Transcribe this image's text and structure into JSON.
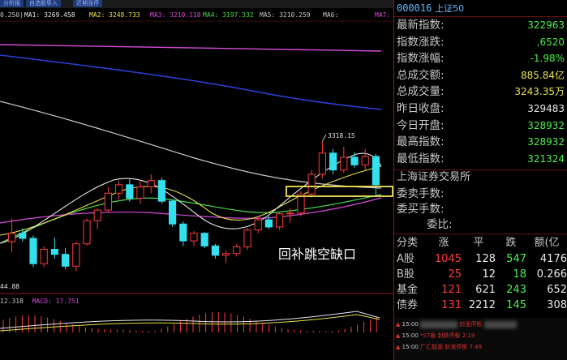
{
  "toolbar": {
    "tabs": [
      "分析报",
      "自选股导入",
      "近期涨停"
    ]
  },
  "ma_legend": [
    {
      "label": "0.250)",
      "color": "#c8c8c8"
    },
    {
      "label": "MA1: 3269.458",
      "color": "#e8e8e8"
    },
    {
      "label": "MA2: 3248.733",
      "color": "#e8e04a"
    },
    {
      "label": "MA3: 3210.118",
      "color": "#d84ad8"
    },
    {
      "label": "MA4: 3197.332",
      "color": "#4ad84a"
    },
    {
      "label": "MA5: 3210.259",
      "color": "#c8c8c8"
    },
    {
      "label": "MA6:",
      "color": "#c8c8c8"
    },
    {
      "label": "MA7:",
      "color": "#d84ad8"
    }
  ],
  "chart": {
    "peak_label": "3318.15",
    "low_label": "44.88",
    "annotation": "回补跳空缺口",
    "macd_legend": [
      {
        "label": "12.318",
        "color": "#c8c8c8"
      },
      {
        "label": "MACD: 17.751",
        "color": "#d84ad8"
      }
    ]
  },
  "chart_data": {
    "type": "candlestick",
    "series": [
      {
        "values": [
          [
            3080,
            3135,
            3055,
            3100
          ],
          [
            3100,
            3112,
            3080,
            3088
          ],
          [
            3088,
            3095,
            3020,
            3028
          ],
          [
            3028,
            3070,
            3020,
            3062
          ],
          [
            3062,
            3090,
            3040,
            3050
          ],
          [
            3050,
            3065,
            3015,
            3022
          ],
          [
            3022,
            3080,
            3010,
            3075
          ],
          [
            3075,
            3135,
            3070,
            3130
          ],
          [
            3130,
            3160,
            3110,
            3155
          ],
          [
            3155,
            3210,
            3150,
            3195
          ],
          [
            3195,
            3225,
            3180,
            3215
          ],
          [
            3215,
            3228,
            3175,
            3183
          ],
          [
            3183,
            3225,
            3170,
            3210
          ],
          [
            3210,
            3240,
            3195,
            3225
          ],
          [
            3225,
            3232,
            3170,
            3176
          ],
          [
            3176,
            3180,
            3115,
            3122
          ],
          [
            3122,
            3128,
            3070,
            3082
          ],
          [
            3082,
            3105,
            3070,
            3100
          ],
          [
            3100,
            3103,
            3065,
            3070
          ],
          [
            3070,
            3075,
            3040,
            3048
          ],
          [
            3048,
            3060,
            3030,
            3052
          ],
          [
            3052,
            3075,
            3045,
            3068
          ],
          [
            3068,
            3112,
            3060,
            3108
          ],
          [
            3108,
            3140,
            3100,
            3132
          ],
          [
            3132,
            3142,
            3110,
            3115
          ],
          [
            3115,
            3152,
            3108,
            3146
          ],
          [
            3146,
            3160,
            3125,
            3148
          ],
          [
            3148,
            3200,
            3140,
            3193
          ],
          [
            3193,
            3250,
            3185,
            3240
          ],
          [
            3240,
            3318,
            3230,
            3290
          ],
          [
            3290,
            3300,
            3240,
            3250
          ],
          [
            3250,
            3305,
            3244,
            3280
          ],
          [
            3280,
            3292,
            3255,
            3262
          ],
          [
            3262,
            3300,
            3250,
            3282
          ],
          [
            3282,
            3288,
            3190,
            3215
          ]
        ]
      }
    ]
  },
  "quote": {
    "code": "000016",
    "name": "上证50",
    "rows": [
      {
        "key": "最新指数:",
        "value": "322963",
        "color": "#4af04a"
      },
      {
        "key": "指数涨跌:",
        "value": ",6520",
        "color": "#4af04a"
      },
      {
        "key": "指数涨幅:",
        "value": "-1.98%",
        "color": "#4af04a"
      },
      {
        "key": "总成交额:",
        "value": "885.84亿",
        "color": "#e8e04a"
      },
      {
        "key": "总成交量:",
        "value": "3243.35万",
        "color": "#e8e04a"
      },
      {
        "key": "昨日收盘:",
        "value": "329483",
        "color": "#e8e8e8"
      },
      {
        "key": "今日开盘:",
        "value": "328932",
        "color": "#4af04a"
      },
      {
        "key": "最高指数:",
        "value": "328932",
        "color": "#4af04a"
      },
      {
        "key": "最低指数:",
        "value": "321324",
        "color": "#4af04a"
      }
    ],
    "exchange": "上海证券交易所",
    "order_rows": [
      {
        "key": "委卖手数:"
      },
      {
        "key": "委买手数:"
      },
      {
        "key": "委比:"
      }
    ]
  },
  "breadth": {
    "headers": [
      "分类",
      "涨",
      "平",
      "跌",
      "额(亿"
    ],
    "rows": [
      {
        "cat": "A股",
        "up": "1045",
        "flat": "128",
        "down": "547",
        "amt": "4176"
      },
      {
        "cat": "B股",
        "up": "25",
        "flat": "12",
        "down": "18",
        "amt": "0.266"
      },
      {
        "cat": "基金",
        "up": "121",
        "flat": "621",
        "down": "243",
        "amt": "652"
      },
      {
        "cat": "债券",
        "up": "131",
        "flat": "2212",
        "down": "145",
        "amt": "308"
      }
    ]
  },
  "ticker": {
    "rows": [
      {
        "time": "15:00",
        "text": "封涨停板"
      },
      {
        "time": "15:00",
        "text": "*ST盾 封跌停板 2.19"
      },
      {
        "time": "15:00",
        "text": "广汇能源 封涨停板 7.49"
      }
    ]
  },
  "colors": {
    "up": "#ff3b3b",
    "down": "#34e0f0",
    "accent": "#5fb8ff",
    "grid_red": "#8a1f1f",
    "highlight": "#f2e35a"
  }
}
